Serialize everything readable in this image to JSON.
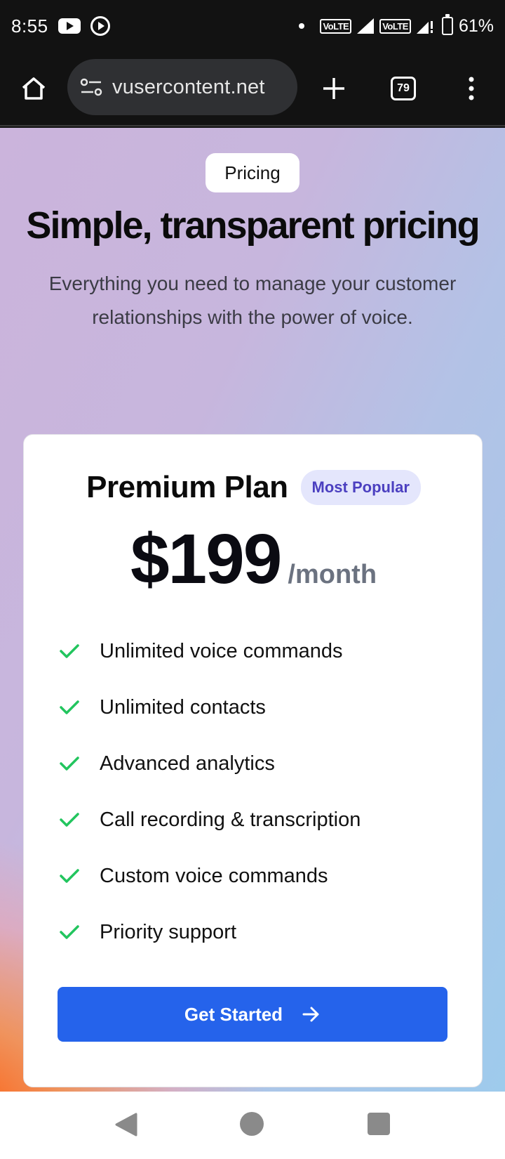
{
  "status_bar": {
    "time": "8:55",
    "volte_1": "VoLTE",
    "volte_2": "VoLTE",
    "battery": "61%"
  },
  "browser": {
    "url": "vusercontent.net",
    "tab_count": "79"
  },
  "hero": {
    "badge": "Pricing",
    "title": "Simple, transparent pricing",
    "subtitle": "Everything you need to manage your customer relationships with the power of voice."
  },
  "plan": {
    "name": "Premium Plan",
    "badge": "Most Popular",
    "price": "$199",
    "period": "/month",
    "features": [
      "Unlimited voice commands",
      "Unlimited contacts",
      "Advanced analytics",
      "Call recording & transcription",
      "Custom voice commands",
      "Priority support"
    ],
    "cta_label": "Get Started"
  },
  "colors": {
    "accent": "#2563eb",
    "check": "#22c55e",
    "badge_bg": "#e4e6fc",
    "badge_text": "#4b3fc0"
  }
}
